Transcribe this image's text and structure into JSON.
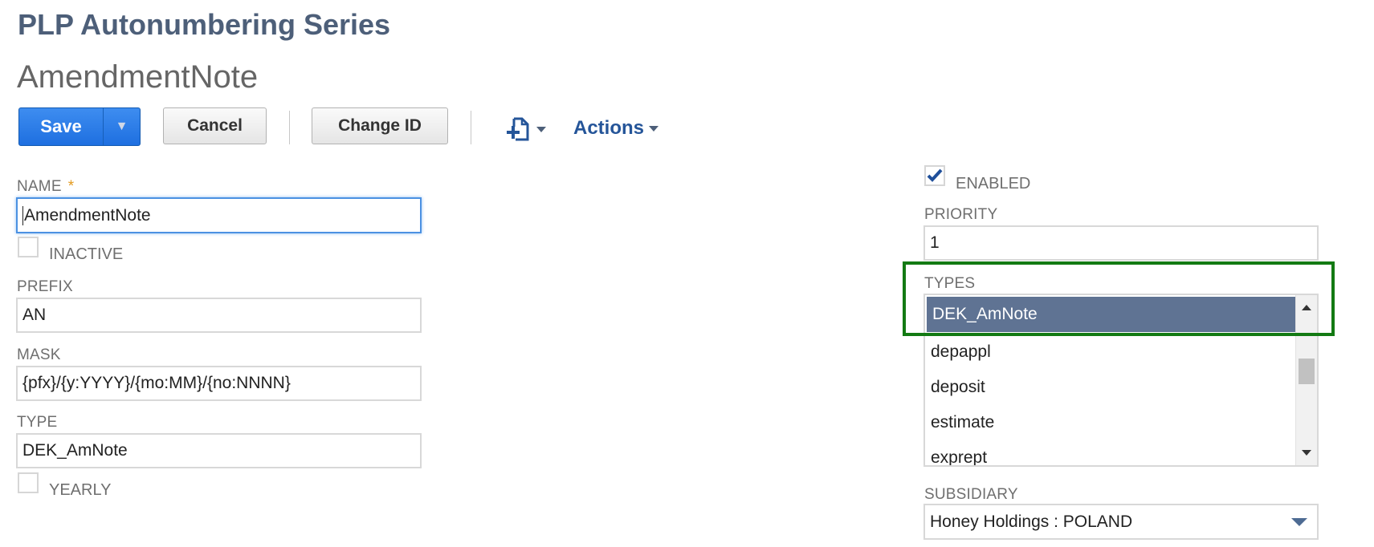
{
  "page": {
    "record_type_title": "PLP Autonumbering Series",
    "record_name": "AmendmentNote"
  },
  "toolbar": {
    "save_label": "Save",
    "save_dropdown_glyph": "▼",
    "cancel_label": "Cancel",
    "change_id_label": "Change ID",
    "new_record_icon": "new-document-plus-icon",
    "actions_label": "Actions"
  },
  "form": {
    "name": {
      "label": "NAME",
      "required_mark": "*",
      "value": "AmendmentNote"
    },
    "inactive": {
      "label": "INACTIVE",
      "checked": false
    },
    "prefix": {
      "label": "PREFIX",
      "value": "AN"
    },
    "mask": {
      "label": "MASK",
      "value": "{pfx}/{y:YYYY}/{mo:MM}/{no:NNNN}"
    },
    "type": {
      "label": "TYPE",
      "value": "DEK_AmNote"
    },
    "yearly": {
      "label": "YEARLY",
      "checked": false
    },
    "enabled": {
      "label": "ENABLED",
      "checked": true
    },
    "priority": {
      "label": "PRIORITY",
      "value": "1"
    },
    "types": {
      "label": "TYPES",
      "items": [
        {
          "label": "DEK_AmNote",
          "selected": true
        },
        {
          "label": "depappl",
          "selected": false
        },
        {
          "label": "deposit",
          "selected": false
        },
        {
          "label": "estimate",
          "selected": false
        },
        {
          "label": "exprept",
          "selected": false
        }
      ]
    },
    "subsidiary": {
      "label": "SUBSIDIARY",
      "value": "Honey Holdings : POLAND"
    }
  },
  "colors": {
    "save_button": "#2a7ae8",
    "selected_item": "#5f7393",
    "highlight_box": "#137a13",
    "title": "#4d5f79"
  }
}
